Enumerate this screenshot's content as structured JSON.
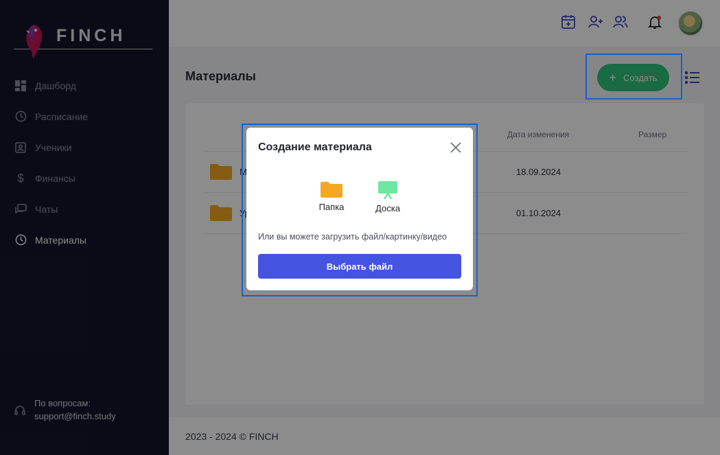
{
  "sidebar": {
    "brand": "FINCH",
    "items": [
      {
        "label": "Дашборд",
        "icon": "dashboard-icon"
      },
      {
        "label": "Расписание",
        "icon": "clock-icon"
      },
      {
        "label": "Ученики",
        "icon": "students-icon"
      },
      {
        "label": "Финансы",
        "icon": "dollar-icon"
      },
      {
        "label": "Чаты",
        "icon": "chat-icon"
      },
      {
        "label": "Материалы",
        "icon": "clock-icon",
        "active": true
      }
    ],
    "support": {
      "line1": "По вопросам:",
      "line2": "support@finch.study",
      "icon": "headset-icon"
    }
  },
  "header": {
    "icons": [
      "calendar-add-icon",
      "add-user-icon",
      "users-icon",
      "bell-icon",
      "avatar"
    ]
  },
  "main": {
    "title": "Материалы",
    "create_label": "Создать",
    "table": {
      "headers": [
        "Дата изменения",
        "Размер"
      ],
      "rows": [
        {
          "name": "М",
          "date": "18.09.2024"
        },
        {
          "name": "Ур",
          "date": "01.10.2024"
        }
      ]
    }
  },
  "footer": {
    "text": "2023 - 2024 © FINCH"
  },
  "modal": {
    "title": "Создание материала",
    "options": [
      {
        "label": "Папка",
        "icon": "folder-icon"
      },
      {
        "label": "Доска",
        "icon": "board-icon"
      }
    ],
    "hint": "Или вы можете загрузить файл/картинку/видео",
    "choose_label": "Выбрать файл"
  },
  "colors": {
    "sidebar_bg": "#14152b",
    "accent_green": "#2cc47a",
    "accent_blue": "#4453e0",
    "folder": "#f5a623",
    "board": "#6ee7a0",
    "highlight": "#1d5fc4"
  }
}
